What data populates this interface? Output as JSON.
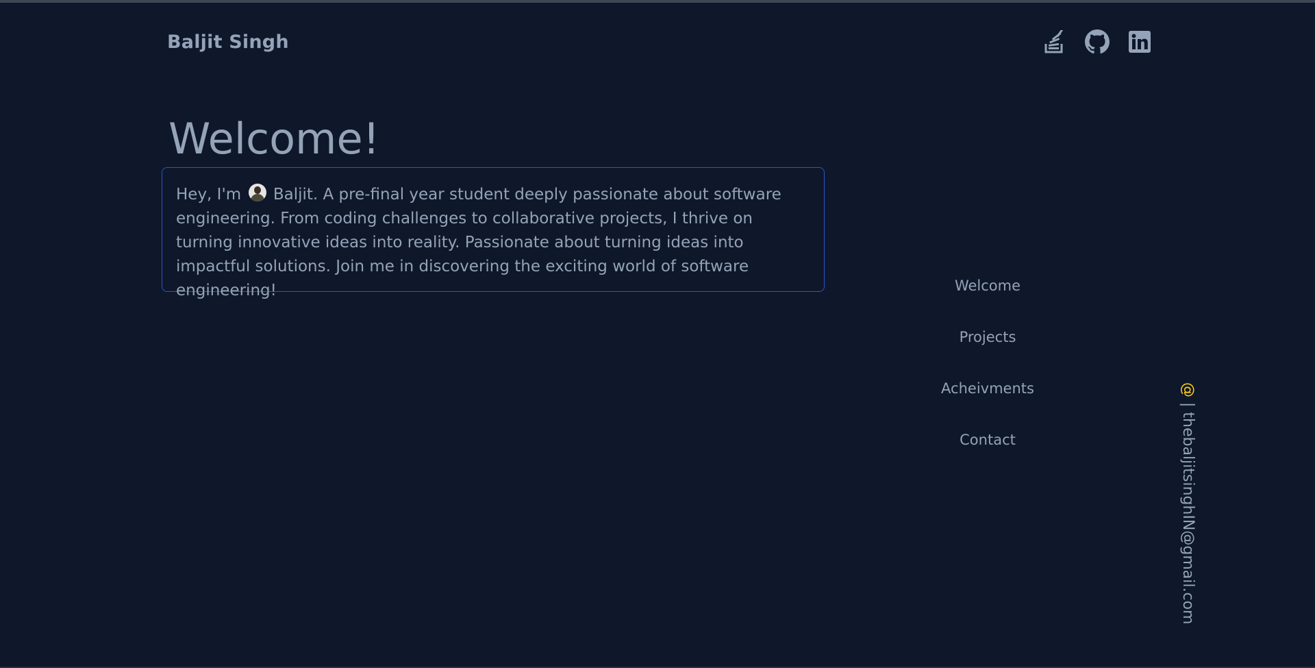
{
  "header": {
    "brand": "Baljit Singh",
    "socials": [
      {
        "name": "stackoverflow-icon"
      },
      {
        "name": "github-icon"
      },
      {
        "name": "linkedin-icon"
      }
    ]
  },
  "main": {
    "title": "Welcome!",
    "intro_before": "Hey, I'm ",
    "intro_after": " Baljit. A pre-final year student deeply passionate about software engineering. From coding challenges to collaborative projects, I thrive on turning innovative ideas into reality. Passionate about turning ideas into impactful solutions. Join me in discovering the exciting world of software engineering!"
  },
  "nav": {
    "items": [
      {
        "label": "Welcome"
      },
      {
        "label": "Projects"
      },
      {
        "label": "Acheivments"
      },
      {
        "label": "Contact"
      }
    ]
  },
  "contact": {
    "at_symbol": "@",
    "email_text": " | thebaljitsinghIN@gmail.com"
  },
  "colors": {
    "background": "#0f172a",
    "text": "#94a3b8",
    "card_border": "#2b56c9",
    "accent": "#facc15"
  }
}
